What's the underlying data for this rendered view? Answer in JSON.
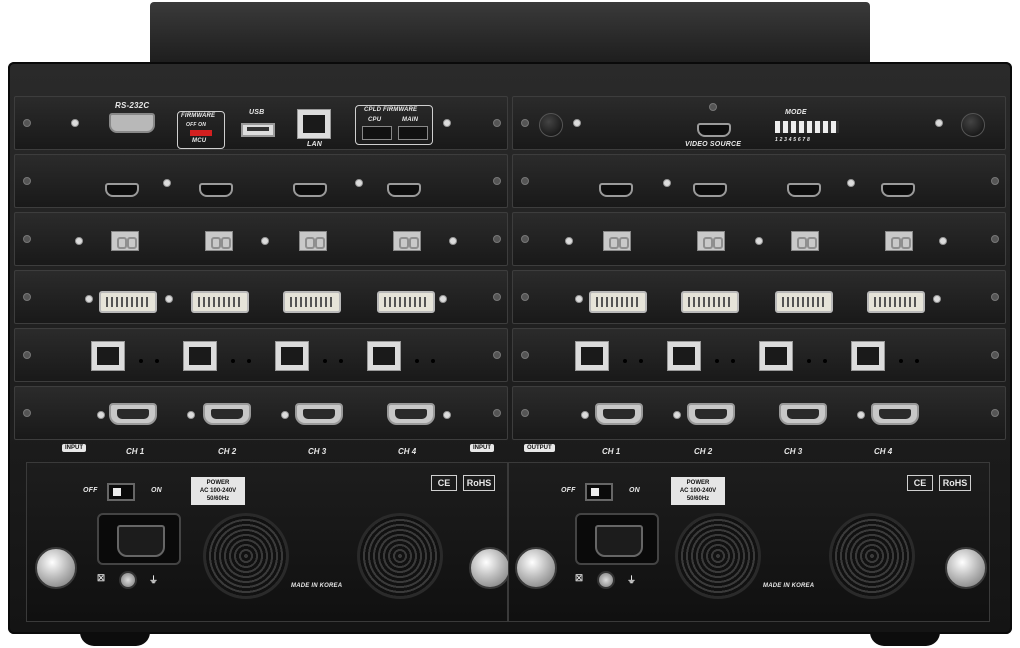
{
  "device": {
    "labels": {
      "rs232c": "RS-232C",
      "firmware_title": "FIRMWARE",
      "firmware_off_on": "OFF  ON",
      "firmware_mcu": "MCU",
      "usb": "USB",
      "lan": "LAN",
      "cpld_title": "CPLD FIRMWARE",
      "cpld_cpu": "CPU",
      "cpld_main": "MAIN",
      "video_source": "VIDEO SOURCE",
      "mode": "MODE",
      "dip_numbers": "1 2 3 4 5 6 7 8"
    },
    "channels": {
      "input": [
        "CH 1",
        "CH 2",
        "CH 3",
        "CH 4"
      ],
      "output": [
        "CH 1",
        "CH 2",
        "CH 3",
        "CH 4"
      ]
    },
    "tags": {
      "input_left": "INPUT",
      "input_right": "INPUT",
      "output": "OUTPUT"
    },
    "psu": {
      "off": "OFF",
      "on": "ON",
      "power_line1": "POWER",
      "power_line2": "AC 100-240V",
      "power_line3": "50/60Hz",
      "ce": "CE",
      "rohs": "RoHS",
      "made_in": "MADE IN KOREA"
    }
  }
}
